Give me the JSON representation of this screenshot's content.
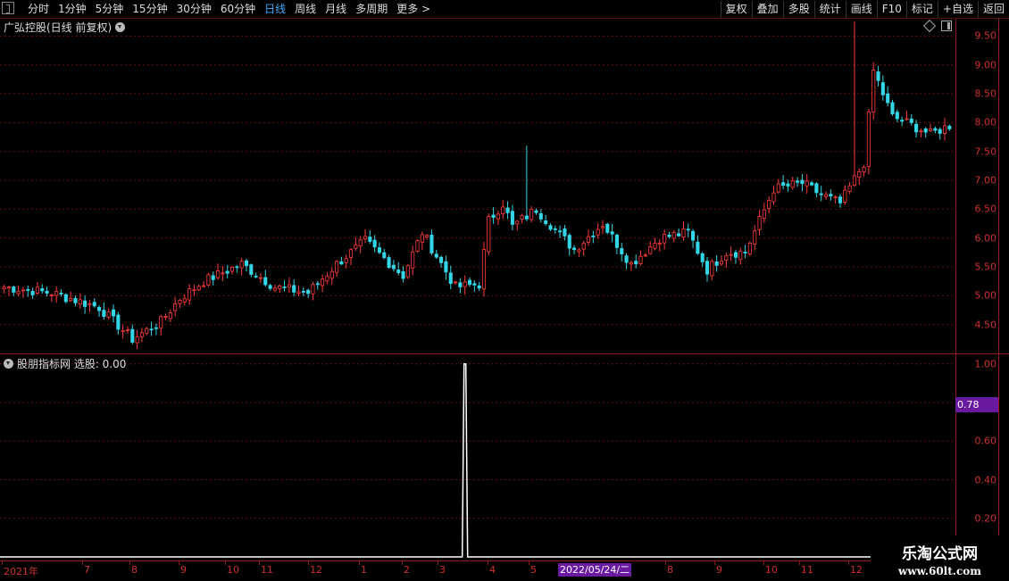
{
  "toolbar": {
    "periods": [
      {
        "label": "分时",
        "active": false
      },
      {
        "label": "1分钟",
        "active": false
      },
      {
        "label": "5分钟",
        "active": false
      },
      {
        "label": "15分钟",
        "active": false
      },
      {
        "label": "30分钟",
        "active": false
      },
      {
        "label": "60分钟",
        "active": false
      },
      {
        "label": "日线",
        "active": true
      },
      {
        "label": "周线",
        "active": false
      },
      {
        "label": "月线",
        "active": false
      },
      {
        "label": "多周期",
        "active": false
      },
      {
        "label": "更多 >",
        "active": false
      }
    ],
    "tools": [
      "复权",
      "叠加",
      "多股",
      "统计",
      "画线",
      "F10",
      "标记",
      "+自选",
      "返回"
    ]
  },
  "main_panel": {
    "title": "广弘控股(日线 前复权)",
    "price_axis": [
      "9.50",
      "9.00",
      "8.50",
      "8.00",
      "7.50",
      "7.00",
      "6.50",
      "6.00",
      "5.50",
      "5.00",
      "4.50"
    ]
  },
  "indicator_panel": {
    "title": "股朋指标网  选股: 0.00",
    "axis": [
      "1.00",
      "0.80",
      "0.60",
      "0.40",
      "0.20"
    ],
    "current_tag": "0.78"
  },
  "date_axis": {
    "labels": [
      "2021年",
      "7",
      "8",
      "9",
      "10",
      "11",
      "12",
      "1",
      "2",
      "3",
      "4",
      "5",
      "8",
      "9",
      "10",
      "11",
      "12"
    ],
    "highlight": "2022/05/24/二"
  },
  "watermark": {
    "line1": "乐淘公式网",
    "line2": "www.60lt.com"
  },
  "colors": {
    "up": "#ff3b3b",
    "down": "#33d6e6",
    "grid": "#6a1010",
    "axis_text": "#cc3030",
    "active_period": "#3da8ff",
    "highlight": "#6a1aa0"
  },
  "chart_data": {
    "type": "candlestick",
    "y_range": [
      4.0,
      9.8
    ],
    "indicator_range": [
      0,
      1.05
    ],
    "signal_index": 97,
    "anchors": [
      [
        0,
        5.15
      ],
      [
        10,
        5.05
      ],
      [
        20,
        4.8
      ],
      [
        27,
        4.25
      ],
      [
        33,
        4.55
      ],
      [
        37,
        4.95
      ],
      [
        42,
        5.25
      ],
      [
        50,
        5.55
      ],
      [
        57,
        5.15
      ],
      [
        64,
        5.05
      ],
      [
        70,
        5.55
      ],
      [
        76,
        5.95
      ],
      [
        84,
        5.35
      ],
      [
        88,
        6.1
      ],
      [
        95,
        5.15
      ],
      [
        100,
        5.2
      ],
      [
        102,
        6.3
      ],
      [
        105,
        6.6
      ],
      [
        107,
        6.2
      ],
      [
        112,
        6.5
      ],
      [
        116,
        6.15
      ],
      [
        120,
        5.8
      ],
      [
        126,
        6.25
      ],
      [
        132,
        5.55
      ],
      [
        138,
        6.0
      ],
      [
        144,
        6.1
      ],
      [
        148,
        5.45
      ],
      [
        152,
        5.75
      ],
      [
        156,
        5.75
      ],
      [
        162,
        6.85
      ],
      [
        168,
        6.95
      ],
      [
        172,
        6.75
      ],
      [
        176,
        6.6
      ],
      [
        181,
        7.3
      ],
      [
        183,
        8.9
      ],
      [
        187,
        8.1
      ],
      [
        190,
        8.0
      ],
      [
        195,
        7.8
      ],
      [
        199,
        7.95
      ]
    ],
    "spikes": [
      [
        110,
        7.6
      ],
      [
        179,
        9.75
      ]
    ]
  }
}
